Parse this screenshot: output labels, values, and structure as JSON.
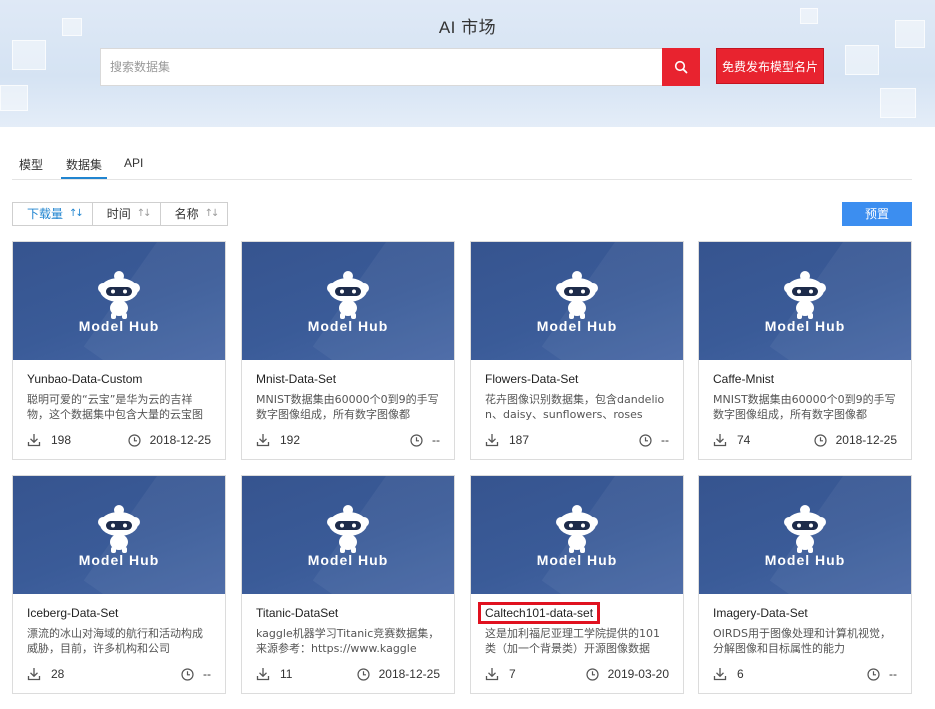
{
  "header": {
    "title": "AI 市场",
    "search_placeholder": "搜索数据集",
    "publish_label": "免费发布模型名片"
  },
  "tabs": [
    {
      "label": "模型",
      "active": false
    },
    {
      "label": "数据集",
      "active": true
    },
    {
      "label": "API",
      "active": false
    }
  ],
  "sort": [
    {
      "label": "下载量",
      "active": true
    },
    {
      "label": "时间",
      "active": false
    },
    {
      "label": "名称",
      "active": false
    }
  ],
  "preset_label": "预置",
  "brand_text": "Model Hub",
  "colors": {
    "accent_red": "#e8232f",
    "accent_blue": "#3c8ef0",
    "card_bg": "#3a5b98"
  },
  "cards": [
    {
      "title": "Yunbao-Data-Custom",
      "desc": "聪明可爱的“云宝”是华为云的吉祥物，这个数据集中包含大量的云宝图片",
      "downloads": "198",
      "date": "2018-12-25"
    },
    {
      "title": "Mnist-Data-Set",
      "desc": "MNIST数据集由60000个0到9的手写数字图像组成，所有数字图像都",
      "downloads": "192",
      "date": "--"
    },
    {
      "title": "Flowers-Data-Set",
      "desc": "花卉图像识别数据集，包含dandelion、daisy、sunflowers、roses",
      "downloads": "187",
      "date": "--"
    },
    {
      "title": "Caffe-Mnist",
      "desc": "MNIST数据集由60000个0到9的手写数字图像组成，所有数字图像都",
      "downloads": "74",
      "date": "2018-12-25"
    },
    {
      "title": "Iceberg-Data-Set",
      "desc": "漂流的冰山对海域的航行和活动构成威胁，目前，许多机构和公司",
      "downloads": "28",
      "date": "--"
    },
    {
      "title": "Titanic-DataSet",
      "desc": "kaggle机器学习Titanic竞赛数据集，来源参考：https://www.kaggle",
      "downloads": "11",
      "date": "2018-12-25"
    },
    {
      "title": "Caltech101-data-set",
      "desc": "这是加利福尼亚理工学院提供的101类（加一个背景类）开源图像数据",
      "downloads": "7",
      "date": "2019-03-20"
    },
    {
      "title": "Imagery-Data-Set",
      "desc": "OIRDS用于图像处理和计算机视觉，分解图像和目标属性的能力",
      "downloads": "6",
      "date": "--"
    }
  ]
}
